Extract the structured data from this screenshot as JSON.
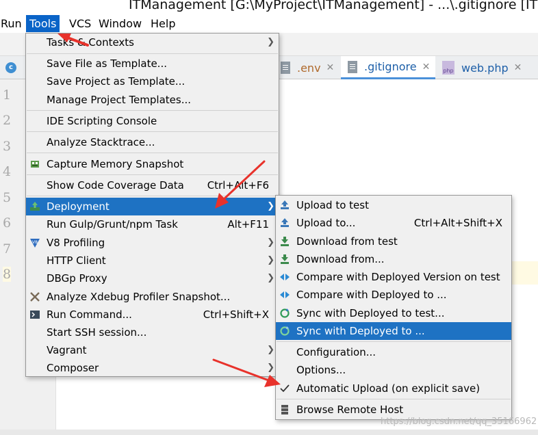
{
  "window": {
    "title": "ITManagement [G:\\MyProject\\ITManagement] - ...\\.gitignore [ITM"
  },
  "menubar": {
    "items": [
      {
        "label": "Run"
      },
      {
        "label": "Tools",
        "active": true
      },
      {
        "label": "VCS"
      },
      {
        "label": "Window"
      },
      {
        "label": "Help"
      }
    ]
  },
  "tabs": [
    {
      "label": ".env",
      "icon": "text-file-icon"
    },
    {
      "label": ".gitignore",
      "icon": "text-file-icon",
      "selected": true
    },
    {
      "label": "web.php",
      "icon": "php-file-icon"
    }
  ],
  "tab_badge": "c",
  "gutter": {
    "line_numbers": [
      "1",
      "2",
      "3",
      "4",
      "5",
      "6",
      "7",
      "8"
    ]
  },
  "tools_menu": {
    "items": [
      {
        "label": "Tasks & Contexts",
        "submenu": true
      },
      {
        "label": "Save File as Template..."
      },
      {
        "label": "Save Project as Template..."
      },
      {
        "label": "Manage Project Templates..."
      },
      {
        "label": "IDE Scripting Console"
      },
      {
        "label": "Analyze Stacktrace..."
      },
      {
        "label": "Capture Memory Snapshot",
        "icon": "memory-snapshot-icon"
      },
      {
        "label": "Show Code Coverage Data",
        "shortcut": "Ctrl+Alt+F6"
      },
      {
        "label": "Deployment",
        "icon": "deployment-icon",
        "submenu": true,
        "highlighted": true
      },
      {
        "label": "Run Gulp/Grunt/npm Task",
        "shortcut": "Alt+F11"
      },
      {
        "label": "V8 Profiling",
        "icon": "v8-icon",
        "submenu": true
      },
      {
        "label": "HTTP Client",
        "submenu": true
      },
      {
        "label": "DBGp Proxy",
        "submenu": true
      },
      {
        "label": "Analyze Xdebug Profiler Snapshot...",
        "icon": "xdebug-icon"
      },
      {
        "label": "Run Command...",
        "icon": "terminal-icon",
        "shortcut": "Ctrl+Shift+X"
      },
      {
        "label": "Start SSH session..."
      },
      {
        "label": "Vagrant",
        "submenu": true
      },
      {
        "label": "Composer",
        "submenu": true
      }
    ]
  },
  "deployment_menu": {
    "items": [
      {
        "label": "Upload to test",
        "icon": "upload-icon"
      },
      {
        "label": "Upload to...",
        "icon": "upload-icon",
        "shortcut": "Ctrl+Alt+Shift+X"
      },
      {
        "label": "Download from test",
        "icon": "download-icon"
      },
      {
        "label": "Download from...",
        "icon": "download-icon"
      },
      {
        "label": "Compare with Deployed Version on test",
        "icon": "compare-icon"
      },
      {
        "label": "Compare with Deployed to ...",
        "icon": "compare-icon"
      },
      {
        "label": "Sync with Deployed to test...",
        "icon": "sync-icon"
      },
      {
        "label": "Sync with Deployed to ...",
        "icon": "sync-icon",
        "highlighted": true
      },
      {
        "label": "Configuration..."
      },
      {
        "label": "Options..."
      },
      {
        "label": "Automatic Upload (on explicit save)",
        "icon": "checkmark-icon",
        "checked": true
      },
      {
        "label": "Browse Remote Host",
        "icon": "server-icon"
      }
    ]
  },
  "watermark": "https://blog.csdn.net/qq_35166962",
  "colors": {
    "menu_highlight": "#1e72c3",
    "menu_background": "#f0f0f0",
    "annotation_arrow": "#e8322b",
    "current_line": "#fffae3"
  }
}
